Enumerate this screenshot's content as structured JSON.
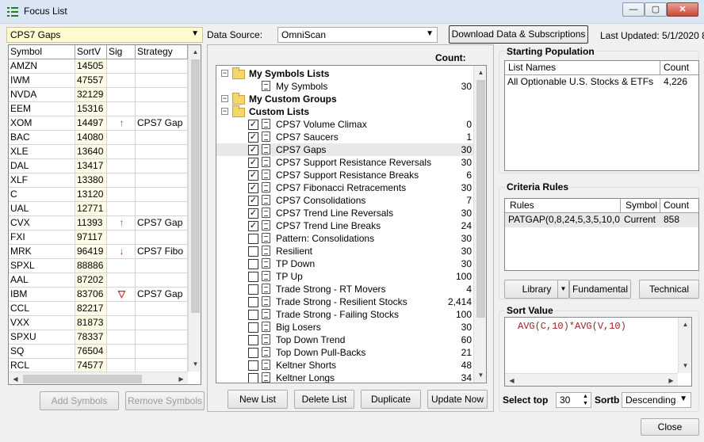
{
  "window": {
    "title": "Focus List",
    "minimize": "—",
    "maximize": "▢",
    "close": "✕"
  },
  "left": {
    "list_combo": "CPS7 Gaps",
    "headers": [
      "Symbol",
      "SortV",
      "Sig",
      "Strategy"
    ],
    "rows": [
      {
        "symbol": "AMZN",
        "sortv": "14505",
        "sig": "",
        "strategy": ""
      },
      {
        "symbol": "IWM",
        "sortv": "47557",
        "sig": "",
        "strategy": ""
      },
      {
        "symbol": "NVDA",
        "sortv": "32129",
        "sig": "",
        "strategy": ""
      },
      {
        "symbol": "EEM",
        "sortv": "15316",
        "sig": "",
        "strategy": ""
      },
      {
        "symbol": "XOM",
        "sortv": "14497",
        "sig": "up",
        "strategy": "CPS7 Gap"
      },
      {
        "symbol": "BAC",
        "sortv": "14080",
        "sig": "",
        "strategy": ""
      },
      {
        "symbol": "XLE",
        "sortv": "13640",
        "sig": "",
        "strategy": ""
      },
      {
        "symbol": "DAL",
        "sortv": "13417",
        "sig": "",
        "strategy": ""
      },
      {
        "symbol": "XLF",
        "sortv": "13380",
        "sig": "",
        "strategy": ""
      },
      {
        "symbol": "C",
        "sortv": "13120",
        "sig": "",
        "strategy": ""
      },
      {
        "symbol": "UAL",
        "sortv": "12771",
        "sig": "",
        "strategy": ""
      },
      {
        "symbol": "CVX",
        "sortv": "11393",
        "sig": "up",
        "strategy": "CPS7 Gap"
      },
      {
        "symbol": "FXI",
        "sortv": "97117",
        "sig": "",
        "strategy": ""
      },
      {
        "symbol": "MRK",
        "sortv": "96419",
        "sig": "down",
        "strategy": "CPS7 Fibo"
      },
      {
        "symbol": "SPXL",
        "sortv": "88886",
        "sig": "",
        "strategy": ""
      },
      {
        "symbol": "AAL",
        "sortv": "87202",
        "sig": "",
        "strategy": ""
      },
      {
        "symbol": "IBM",
        "sortv": "83706",
        "sig": "tri",
        "strategy": "CPS7 Gap"
      },
      {
        "symbol": "CCL",
        "sortv": "82217",
        "sig": "",
        "strategy": ""
      },
      {
        "symbol": "VXX",
        "sortv": "81873",
        "sig": "",
        "strategy": ""
      },
      {
        "symbol": "SPXU",
        "sortv": "78337",
        "sig": "",
        "strategy": ""
      },
      {
        "symbol": "SQ",
        "sortv": "76504",
        "sig": "",
        "strategy": ""
      },
      {
        "symbol": "RCL",
        "sortv": "74577",
        "sig": "",
        "strategy": ""
      }
    ],
    "add_button": "Add Symbols",
    "remove_button": "Remove Symbols"
  },
  "toolbar": {
    "datasource_label": "Data Source:",
    "datasource_value": "OmniScan",
    "download_button": "Download Data & Subscriptions",
    "last_updated": "Last Updated: 5/1/2020 8"
  },
  "tree": {
    "count_header": "Count:",
    "items": [
      {
        "kind": "group",
        "label": "My Symbols Lists",
        "count": ""
      },
      {
        "kind": "doc",
        "label": "My Symbols",
        "count": "30",
        "checked": null
      },
      {
        "kind": "group",
        "label": "My Custom Groups",
        "count": ""
      },
      {
        "kind": "group",
        "label": "Custom Lists",
        "count": ""
      },
      {
        "kind": "doc",
        "label": "CPS7 Volume Climax",
        "count": "0",
        "checked": true
      },
      {
        "kind": "doc",
        "label": "CPS7 Saucers",
        "count": "1",
        "checked": true
      },
      {
        "kind": "doc",
        "label": "CPS7 Gaps",
        "count": "30",
        "checked": true
      },
      {
        "kind": "doc",
        "label": "CPS7 Support Resistance Reversals",
        "count": "30",
        "checked": true
      },
      {
        "kind": "doc",
        "label": "CPS7 Support Resistance Breaks",
        "count": "6",
        "checked": true
      },
      {
        "kind": "doc",
        "label": "CPS7 Fibonacci Retracements",
        "count": "30",
        "checked": true
      },
      {
        "kind": "doc",
        "label": "CPS7 Consolidations",
        "count": "7",
        "checked": true
      },
      {
        "kind": "doc",
        "label": "CPS7 Trend Line Reversals",
        "count": "30",
        "checked": true
      },
      {
        "kind": "doc",
        "label": "CPS7 Trend Line Breaks",
        "count": "24",
        "checked": true
      },
      {
        "kind": "doc",
        "label": "Pattern: Consolidations",
        "count": "30",
        "checked": false
      },
      {
        "kind": "doc",
        "label": "Resilient",
        "count": "30",
        "checked": false
      },
      {
        "kind": "doc",
        "label": "TP Down",
        "count": "30",
        "checked": false
      },
      {
        "kind": "doc",
        "label": "TP Up",
        "count": "100",
        "checked": false
      },
      {
        "kind": "doc",
        "label": "Trade Strong - RT Movers",
        "count": "4",
        "checked": false
      },
      {
        "kind": "doc",
        "label": "Trade Strong - Resilient Stocks",
        "count": "2,414",
        "checked": false
      },
      {
        "kind": "doc",
        "label": "Trade Strong - Failing Stocks",
        "count": "100",
        "checked": false
      },
      {
        "kind": "doc",
        "label": "Big Losers",
        "count": "30",
        "checked": false
      },
      {
        "kind": "doc",
        "label": "Top Down Trend",
        "count": "60",
        "checked": false
      },
      {
        "kind": "doc",
        "label": "Top Down Pull-Backs",
        "count": "21",
        "checked": false
      },
      {
        "kind": "doc",
        "label": "Keltner Shorts",
        "count": "48",
        "checked": false
      },
      {
        "kind": "doc",
        "label": "Keltner Longs",
        "count": "34",
        "checked": false
      }
    ],
    "new_list": "New List",
    "delete_list": "Delete List",
    "duplicate": "Duplicate",
    "update_now": "Update Now"
  },
  "starting_population": {
    "title": "Starting Population",
    "headers": [
      "List Names",
      "Count"
    ],
    "rows": [
      {
        "name": "All Optionable U.S. Stocks & ETFs",
        "count": "4,226"
      }
    ]
  },
  "criteria_rules": {
    "title": "Criteria Rules",
    "headers": [
      "Rules",
      "Symbol",
      "Count"
    ],
    "rows": [
      {
        "rule": "PATGAP(0,8,24,5,3,5,10,0...",
        "symbol": "Current",
        "count": "858"
      }
    ],
    "library": "Library",
    "fundamental": "Fundamental",
    "technical": "Technical"
  },
  "sort_value": {
    "title": "Sort Value",
    "formula": "AVG(C,10)*AVG(V,10)",
    "select_top_label": "Select top",
    "select_top_value": "30",
    "sort_label": "Sortb",
    "sort_value": "Descending"
  },
  "close_button": "Close",
  "colors": {
    "up": "#1a8c1a",
    "down": "#d42020",
    "selected_row": "#e8e8e8",
    "sortv_bg": "#fffce6"
  }
}
